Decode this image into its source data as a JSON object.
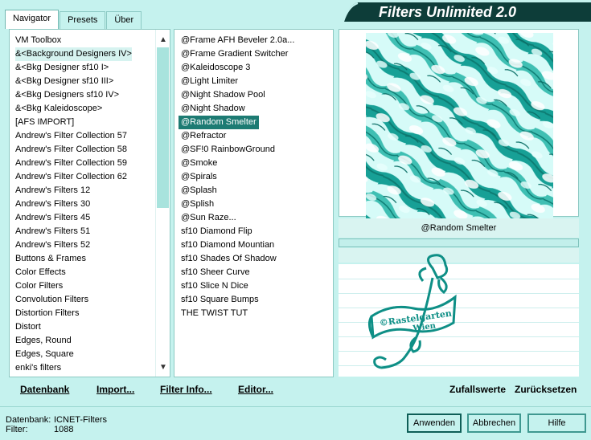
{
  "tabs": [
    {
      "label": "Navigator"
    },
    {
      "label": "Presets"
    },
    {
      "label": "Über"
    }
  ],
  "banner": {
    "title": "Filters Unlimited 2.0"
  },
  "categories": [
    "VM Toolbox",
    "&<Background Designers IV>",
    "&<Bkg Designer sf10 I>",
    "&<Bkg Designer sf10 III>",
    "&<Bkg Designers sf10 IV>",
    "&<Bkg Kaleidoscope>",
    "[AFS IMPORT]",
    "Andrew's Filter Collection 57",
    "Andrew's Filter Collection 58",
    "Andrew's Filter Collection 59",
    "Andrew's Filter Collection 62",
    "Andrew's Filters 12",
    "Andrew's Filters 30",
    "Andrew's Filters 45",
    "Andrew's Filters 51",
    "Andrew's Filters 52",
    "Buttons & Frames",
    "Color Effects",
    "Color Filters",
    "Convolution Filters",
    "Distortion Filters",
    "Distort",
    "Edges, Round",
    "Edges, Square",
    "enki's filters"
  ],
  "filters": [
    "@Frame AFH Beveler 2.0a...",
    "@Frame Gradient Switcher",
    "@Kaleidoscope 3",
    "@Light Limiter",
    "@Night Shadow Pool",
    "@Night Shadow",
    "@Random Smelter",
    "@Refractor",
    "@SF!0 RainbowGround",
    "@Smoke",
    "@Spirals",
    "@Splash",
    "@Splish",
    "@Sun Raze...",
    "sf10 Diamond Flip",
    "sf10 Diamond Mountian",
    "sf10 Shades Of Shadow",
    "sf10 Sheer Curve",
    "sf10 Slice N Dice",
    "sf10 Square Bumps",
    "THE TWIST TUT"
  ],
  "selected_category_index": 1,
  "selected_filter_index": 6,
  "preview": {
    "filter_name": "@Random Smelter"
  },
  "logo": {
    "text_line1": "©Rastelgarten",
    "text_line2": "Wien"
  },
  "bottom": {
    "datenbank": "Datenbank",
    "import": "Import...",
    "filter_info": "Filter Info...",
    "editor": "Editor...",
    "zufallswerte": "Zufallswerte",
    "zuruecksetzen": "Zurücksetzen"
  },
  "status": {
    "db_label": "Datenbank:",
    "db_value": "ICNET-Filters",
    "filter_label": "Filter:",
    "filter_value": "1088"
  },
  "buttons": {
    "apply": "Anwenden",
    "cancel": "Abbrechen",
    "help": "Hilfe"
  },
  "colors": {
    "accent": "#1d7b73",
    "bg": "#c5f2ee",
    "preview_teal": "#17a096"
  }
}
